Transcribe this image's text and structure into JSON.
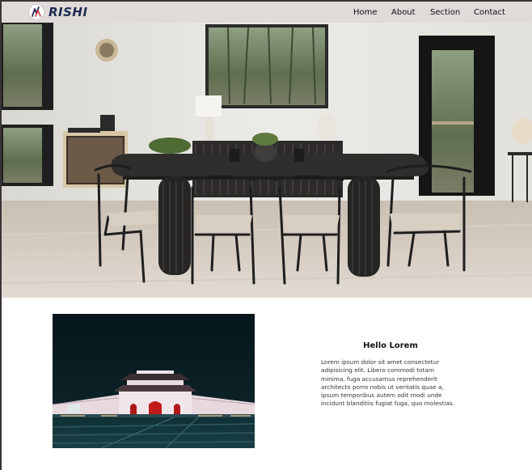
{
  "brand": {
    "name": "RISHI",
    "color": "#1f2a52"
  },
  "nav": {
    "links": [
      {
        "label": "Home"
      },
      {
        "label": "About"
      },
      {
        "label": "Section"
      },
      {
        "label": "Contact"
      }
    ]
  },
  "hero": {
    "image_subject": "dining room with black table, wishbone chairs and large windows"
  },
  "feature": {
    "image_subject": "illuminated palace gate at night",
    "title": "Hello Lorem",
    "body": "Lorem ipsum dolor sit amet consectetur adipisicing elit. Libero commodi totam minima, fuga accusamus reprehenderit architecto porro nobis ut veritatis quae a, ipsum temporibus autem odit modi unde incidunt blanditiis fugiat fuga, quo molestias."
  },
  "colors": {
    "navbar_bg": "#dedbd8",
    "page_bg": "#ffffff",
    "border": "#3a3436"
  }
}
